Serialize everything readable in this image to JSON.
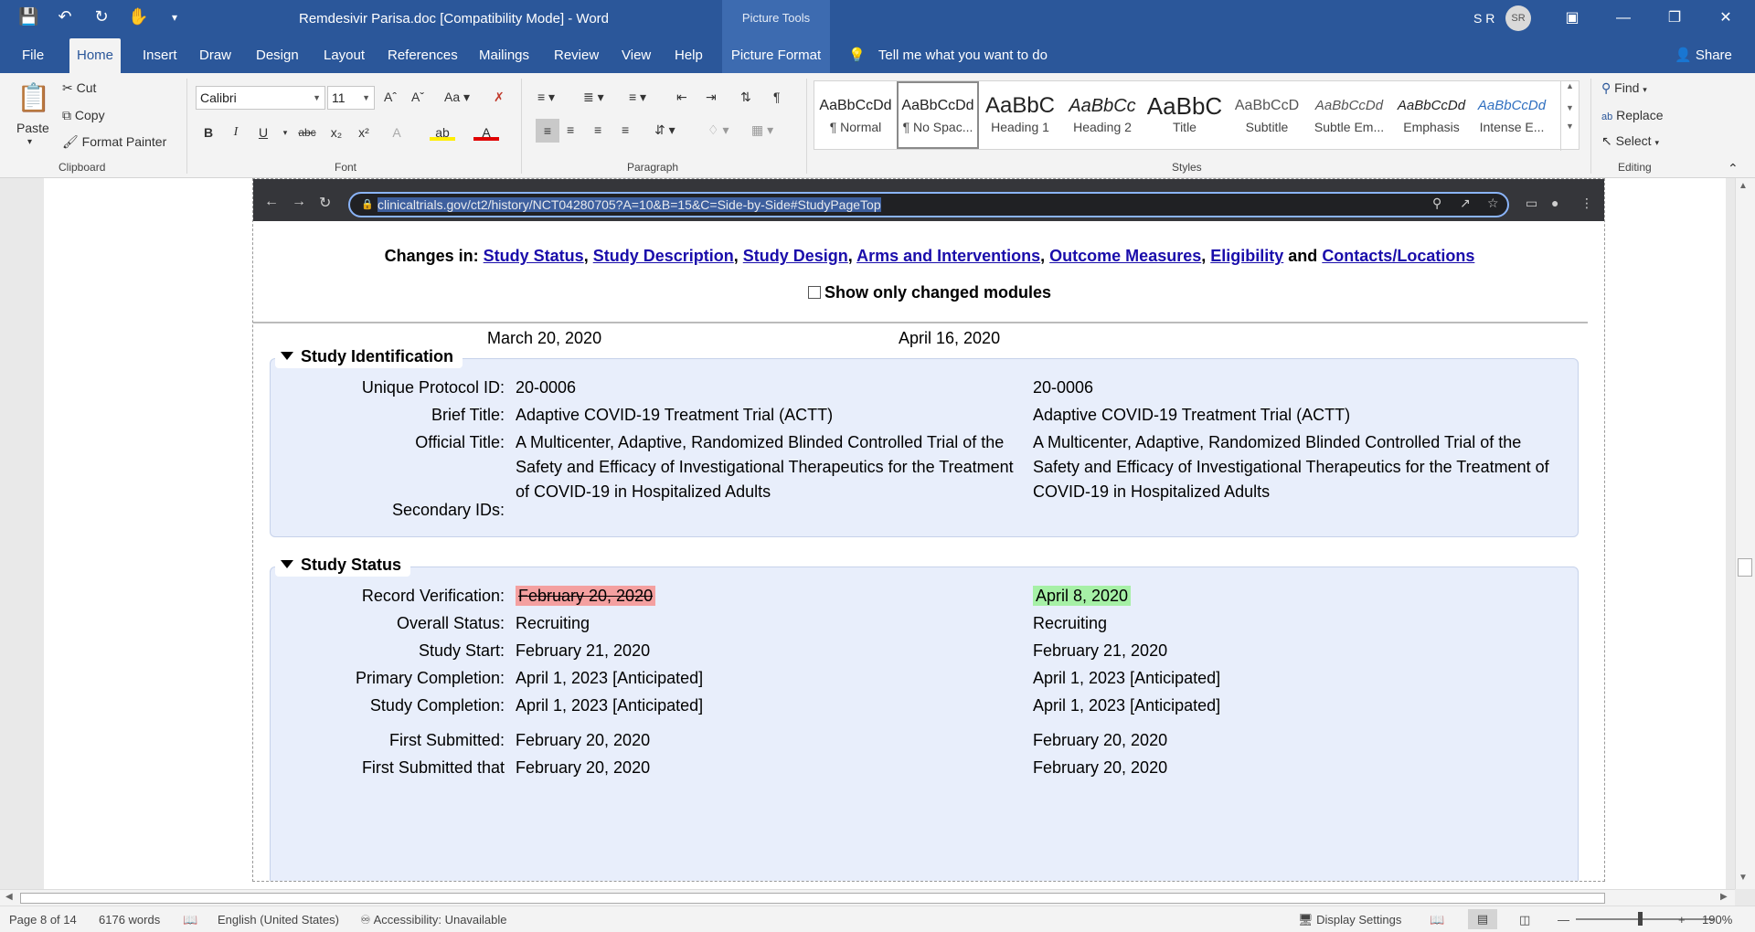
{
  "titlebar": {
    "doc_title": "Remdesivir Parisa.doc [Compatibility Mode]  -  Word",
    "contextual_tab": "Picture Tools",
    "user_initials": "S R",
    "avatar": "SR"
  },
  "tabs": [
    "File",
    "Home",
    "Insert",
    "Draw",
    "Design",
    "Layout",
    "References",
    "Mailings",
    "Review",
    "View",
    "Help",
    "Picture Format"
  ],
  "tell_me": "Tell me what you want to do",
  "share": "Share",
  "ribbon": {
    "clipboard": {
      "label": "Clipboard",
      "paste": "Paste",
      "cut": "Cut",
      "copy": "Copy",
      "format_painter": "Format Painter"
    },
    "font": {
      "label": "Font",
      "font_name": "Calibri",
      "font_size": "11"
    },
    "paragraph": {
      "label": "Paragraph"
    },
    "styles": {
      "label": "Styles",
      "items": [
        {
          "sample": "AaBbCcDd",
          "name": "¶ Normal"
        },
        {
          "sample": "AaBbCcDd",
          "name": "¶ No Spac..."
        },
        {
          "sample": "AaBbC",
          "name": "Heading 1"
        },
        {
          "sample": "AaBbCc",
          "name": "Heading 2"
        },
        {
          "sample": "AaBbC",
          "name": "Title"
        },
        {
          "sample": "AaBbCcD",
          "name": "Subtitle"
        },
        {
          "sample": "AaBbCcDd",
          "name": "Subtle Em..."
        },
        {
          "sample": "AaBbCcDd",
          "name": "Emphasis"
        },
        {
          "sample": "AaBbCcDd",
          "name": "Intense E..."
        }
      ]
    },
    "editing": {
      "label": "Editing",
      "find": "Find",
      "replace": "Replace",
      "select": "Select"
    }
  },
  "browser": {
    "url": "clinicaltrials.gov/ct2/history/NCT04280705?A=10&B=15&C=Side-by-Side#StudyPageTop"
  },
  "web": {
    "changes_in": "Changes in:",
    "links": [
      "Study Status",
      "Study Description",
      "Study Design",
      "Arms and Interventions",
      "Outcome Measures",
      "Eligibility"
    ],
    "and": "and",
    "last_link": "Contacts/Locations",
    "show_only": "Show only changed modules",
    "date_a": "March 20, 2020",
    "date_b": "April 16, 2020",
    "study_identification": {
      "title": "Study Identification",
      "rows": [
        {
          "label": "Unique Protocol ID:",
          "a": "20-0006",
          "b": "20-0006"
        },
        {
          "label": "Brief Title:",
          "a": "Adaptive COVID-19 Treatment Trial (ACTT)",
          "b": "Adaptive COVID-19 Treatment Trial (ACTT)"
        },
        {
          "label": "Official Title:",
          "a": "A Multicenter, Adaptive, Randomized Blinded Controlled Trial of the Safety and Efficacy of Investigational Therapeutics for the Treatment of COVID-19 in Hospitalized Adults",
          "b": "A Multicenter, Adaptive, Randomized Blinded Controlled Trial of the Safety and Efficacy of Investigational Therapeutics for the Treatment of COVID-19 in Hospitalized Adults"
        },
        {
          "label": "Secondary IDs:",
          "a": "",
          "b": ""
        }
      ]
    },
    "study_status": {
      "title": "Study Status",
      "rows": [
        {
          "label": "Record Verification:",
          "a": "February 20, 2020",
          "b": "April 8, 2020"
        },
        {
          "label": "Overall Status:",
          "a": "Recruiting",
          "b": "Recruiting"
        },
        {
          "label": "Study Start:",
          "a": "February 21, 2020",
          "b": "February 21, 2020"
        },
        {
          "label": "Primary Completion:",
          "a": "April 1, 2023 [Anticipated]",
          "b": "April 1, 2023 [Anticipated]"
        },
        {
          "label": "Study Completion:",
          "a": "April 1, 2023 [Anticipated]",
          "b": "April 1, 2023 [Anticipated]"
        },
        {
          "label": "First Submitted:",
          "a": "February 20, 2020",
          "b": "February 20, 2020"
        },
        {
          "label": "First Submitted that",
          "a": "February 20, 2020",
          "b": "February 20, 2020"
        }
      ]
    }
  },
  "statusbar": {
    "page": "Page 8 of 14",
    "words": "6176 words",
    "language": "English (United States)",
    "accessibility": "Accessibility: Unavailable",
    "display_settings": "Display Settings",
    "zoom": "190%"
  }
}
